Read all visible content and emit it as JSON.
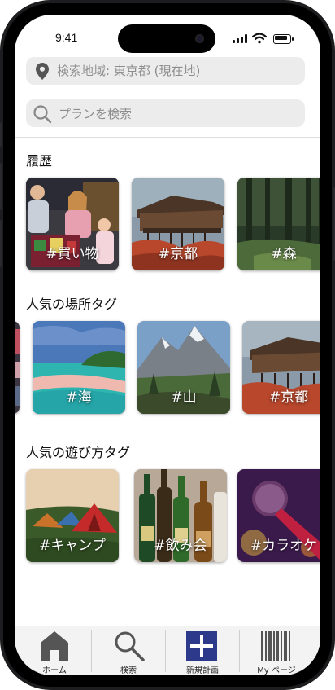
{
  "status": {
    "time": "9:41"
  },
  "location": {
    "label": "検索地域: 東京都 (現在地)"
  },
  "search": {
    "placeholder": "プランを検索"
  },
  "sections": {
    "history": {
      "title": "履歴",
      "cards": [
        {
          "tag": "#買い物",
          "scene": "shopping"
        },
        {
          "tag": "#京都",
          "scene": "kyoto-temple"
        },
        {
          "tag": "#森",
          "scene": "forest"
        }
      ]
    },
    "places": {
      "title": "人気の場所タグ",
      "cards": [
        {
          "tag": "#海",
          "scene": "beach"
        },
        {
          "tag": "#山",
          "scene": "mountain"
        },
        {
          "tag": "#京都",
          "scene": "kyoto-temple"
        }
      ]
    },
    "activities": {
      "title": "人気の遊び方タグ",
      "cards": [
        {
          "tag": "#キャンプ",
          "scene": "camping-tents"
        },
        {
          "tag": "#飲み会",
          "scene": "beer-bottles"
        },
        {
          "tag": "#カラオケ",
          "scene": "microphone"
        }
      ]
    }
  },
  "tabbar": {
    "items": [
      {
        "label": "ホーム",
        "icon": "home-icon"
      },
      {
        "label": "検索",
        "icon": "search-icon"
      },
      {
        "label": "新規計画",
        "icon": "plus-icon"
      },
      {
        "label": "My ページ",
        "icon": "barcode-icon"
      }
    ]
  },
  "colors": {
    "accent": "#2d3a8c",
    "field_bg": "#ececec",
    "tab_icon": "#555555"
  }
}
